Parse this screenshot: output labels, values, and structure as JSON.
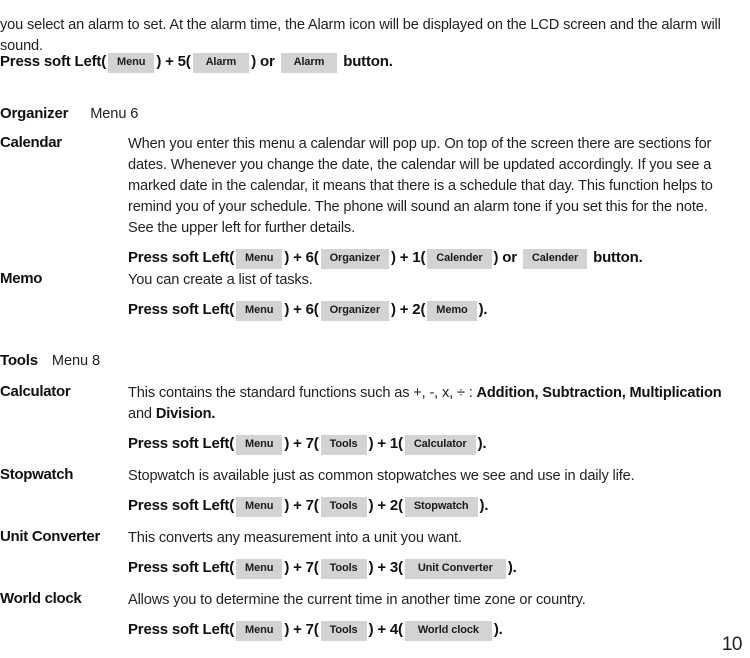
{
  "document": {
    "page_number": "10"
  },
  "intro": {
    "paragraph": "you select an alarm to set. At the alarm time, the Alarm icon will be displayed on the LCD screen and the alarm will sound."
  },
  "alarm_press": {
    "prefix": "Press soft Left(",
    "chip1": "Menu",
    "mid1": ") + 5(",
    "chip2": "Alarm",
    "mid2": ") or",
    "chip3": "Alarm",
    "suffix": "button."
  },
  "sections": [
    {
      "name": "Organizer",
      "menu": "Menu 6",
      "entries": [
        {
          "label": "Calendar",
          "body": "When you enter this menu a calendar will pop up. On top of the screen there are sections for dates. Whenever you change the date, the calendar will be updated accordingly. If you see a marked date in the calendar, it means that there is a schedule that day. This function helps to remind you of your schedule. The phone will sound an alarm tone if you set this for the note. See the upper left for further details.",
          "press": {
            "prefix": "Press soft Left(",
            "chip1": "Menu",
            "mid1": ") + 6(",
            "chip2": "Organizer",
            "mid2": ") + 1(",
            "chip3": "Calender",
            "mid3": ") or",
            "chip4": "Calender",
            "suffix": "button."
          }
        },
        {
          "label": "Memo",
          "body": "You can create a list of tasks.",
          "press": {
            "prefix": "Press soft Left(",
            "chip1": "Menu",
            "mid1": ") + 6(",
            "chip2": "Organizer",
            "mid2": ") + 2(",
            "chip3": "Memo",
            "suffix": ")."
          }
        }
      ]
    },
    {
      "name": "Tools",
      "menu": "Menu 8",
      "entries": [
        {
          "label": "Calculator",
          "body_part1": "This contains the standard functions such as +, -, x, ÷ : ",
          "body_bold1": "Addition, Subtraction, Multiplication",
          "body_part2": " and ",
          "body_bold2": "Division.",
          "press": {
            "prefix": "Press soft Left(",
            "chip1": "Menu",
            "mid1": ") + 7(",
            "chip2": "Tools",
            "mid2": ") + 1(",
            "chip3": "Calculator",
            "suffix": ")."
          }
        },
        {
          "label": "Stopwatch",
          "body": "Stopwatch is available just as common stopwatches we see and use in daily life.",
          "press": {
            "prefix": "Press soft Left(",
            "chip1": "Menu",
            "mid1": ") + 7(",
            "chip2": "Tools",
            "mid2": ") + 2(",
            "chip3": "Stopwatch",
            "suffix": ")."
          }
        },
        {
          "label": "Unit Converter",
          "body": "This converts any measurement into a unit you want.",
          "press": {
            "prefix": "Press soft Left(",
            "chip1": "Menu",
            "mid1": ") + 7(",
            "chip2": "Tools",
            "mid2": ") + 3(",
            "chip3": "Unit Converter",
            "suffix": ")."
          }
        },
        {
          "label": "World clock",
          "body": "Allows you to determine the current time in another time zone or country.",
          "press": {
            "prefix": "Press soft Left(",
            "chip1": "Menu",
            "mid1": ") + 7(",
            "chip2": "Tools",
            "mid2": ") + 4(",
            "chip3": "World clock",
            "suffix": ")."
          }
        }
      ]
    }
  ]
}
